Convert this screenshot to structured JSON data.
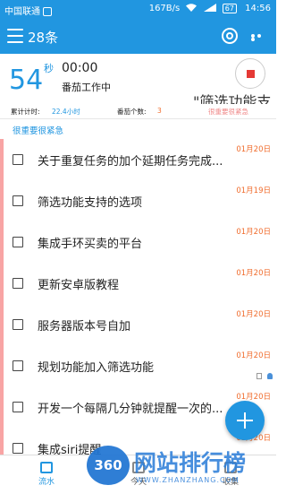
{
  "status_bar": {
    "carrier": "中国联通",
    "net_speed": "167B/s",
    "battery": "67",
    "time": "14:56"
  },
  "app_bar": {
    "title": "28条",
    "icons": [
      "menu-icon",
      "target-icon",
      "more-icon"
    ]
  },
  "timer": {
    "count": "54",
    "unit": "秒",
    "clock": "00:00",
    "status": "番茄工作中",
    "task_note": "\"筛选功能支持的选项\""
  },
  "stats": {
    "total_label": "累计计时:",
    "total_value": "22.4小时",
    "pomodoro_label": "番茄个数:",
    "pomodoro_value": "3",
    "priority": "很重要很紧急"
  },
  "category": "很重要很紧急",
  "colors": {
    "primary": "#2196e0",
    "date": "#f06d2e",
    "priority_bar": "#f8a4a4",
    "stop": "#e53935"
  },
  "tasks": [
    {
      "text": "关于重复任务的加个延期任务完成...",
      "date": "01月20日"
    },
    {
      "text": "筛选功能支持的选项",
      "date": "01月19日"
    },
    {
      "text": "集成手环买卖的平台",
      "date": "01月20日"
    },
    {
      "text": "更新安卓版教程",
      "date": "01月20日"
    },
    {
      "text": "服务器版本号自加",
      "date": "01月20日"
    },
    {
      "text": "规划功能加入筛选功能",
      "date": "01月20日"
    },
    {
      "text": "开发一个每隔几分钟就提醒一次的...",
      "date": "01月20日"
    },
    {
      "text": "集成siri提醒",
      "date": "01月20日"
    }
  ],
  "bottom_nav": {
    "stream": "流水",
    "today": "今天",
    "inbox": "收集"
  },
  "watermark": {
    "logo": "360",
    "cn": "网站排行榜",
    "en": "WWW.ZHANZHANG.COM"
  }
}
